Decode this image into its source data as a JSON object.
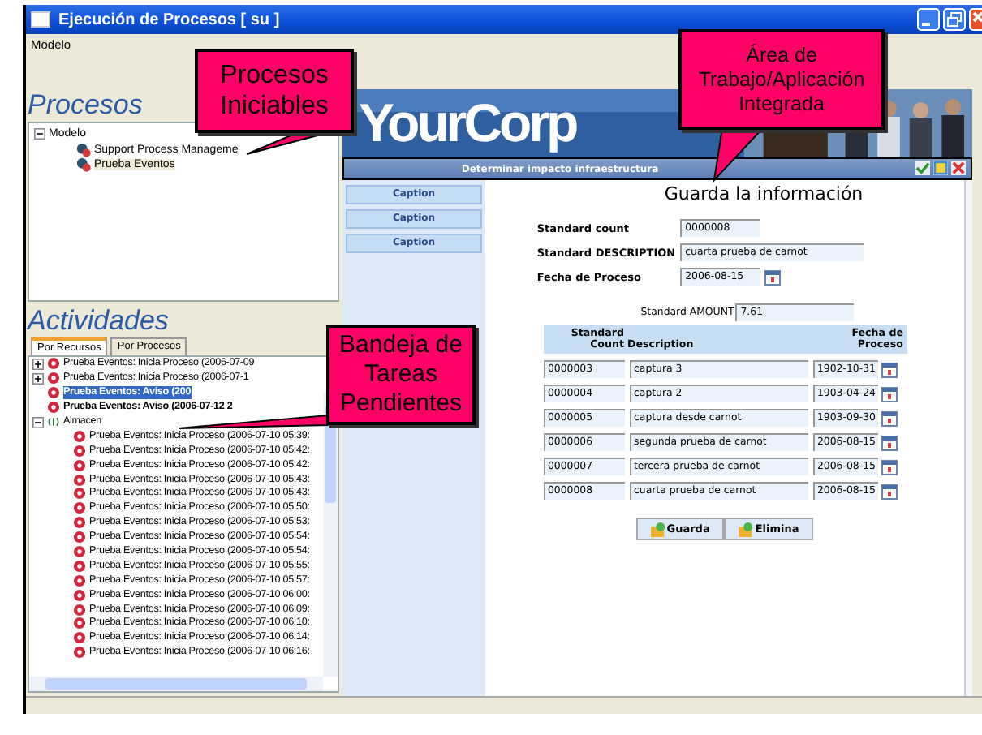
{
  "window": {
    "title": "Ejecución de Procesos [ su ]"
  },
  "menu": [
    "Modelo"
  ],
  "procesos": {
    "heading": "Procesos",
    "tree": [
      {
        "label": "Modelo",
        "expanded": true,
        "children": [
          {
            "label": "Support Process Manageme",
            "selected": false
          },
          {
            "label": "Prueba Eventos",
            "selected": true
          }
        ]
      }
    ]
  },
  "actividades": {
    "heading": "Actividades",
    "tabs": [
      {
        "label": "Por Recursos",
        "selected": true
      },
      {
        "label": "Por Procesos",
        "selected": false
      }
    ],
    "items": [
      {
        "kind": "branch",
        "label": "Prueba Eventos: Inicia Proceso (2006-07-09",
        "expanded": false,
        "unread": false,
        "selected": false
      },
      {
        "kind": "branch",
        "label": "Prueba Eventos: Inicia Proceso (2006-07-1",
        "expanded": false,
        "unread": false,
        "selected": false
      },
      {
        "kind": "event",
        "label": "Prueba Eventos: Aviso (200",
        "unread": true,
        "selected": true
      },
      {
        "kind": "event",
        "label": "Prueba Eventos: Aviso (2006-07-12 2",
        "unread": true,
        "selected": false
      },
      {
        "kind": "group",
        "label": "Almacen",
        "expanded": true,
        "unread": false,
        "selected": false,
        "children": [
          {
            "label": "Prueba Eventos: Inicia Proceso (2006-07-10 05:39:",
            "selected": false
          },
          {
            "label": "Prueba Eventos: Inicia Proceso (2006-07-10 05:42:",
            "selected": false
          },
          {
            "label": "Prueba Eventos: Inicia Proceso (2006-07-10 05:42:",
            "selected": false
          },
          {
            "label": "Prueba Eventos: Inicia Proceso (2006-07-10 05:43:",
            "selected": false
          },
          {
            "label": "Prueba Eventos: Inicia Proceso (2006-07-10 05:43:",
            "selected": false
          },
          {
            "label": "Prueba Eventos: Inicia Proceso (2006-07-10 05:50:",
            "selected": false
          },
          {
            "label": "Prueba Eventos: Inicia Proceso (2006-07-10 05:53:",
            "selected": false
          },
          {
            "label": "Prueba Eventos: Inicia Proceso (2006-07-10 05:54:",
            "selected": false
          },
          {
            "label": "Prueba Eventos: Inicia Proceso (2006-07-10 05:54:",
            "selected": false
          },
          {
            "label": "Prueba Eventos: Inicia Proceso (2006-07-10 05:55:",
            "selected": false
          },
          {
            "label": "Prueba Eventos: Inicia Proceso (2006-07-10 05:57:",
            "selected": false
          },
          {
            "label": "Prueba Eventos: Inicia Proceso (2006-07-10 06:00:",
            "selected": false
          },
          {
            "label": "Prueba Eventos: Inicia Proceso (2006-07-10 06:09:",
            "selected": false
          },
          {
            "label": "Prueba Eventos: Inicia Proceso (2006-07-10 06:10:",
            "selected": false
          },
          {
            "label": "Prueba Eventos: Inicia Proceso (2006-07-10 06:14:",
            "selected": false
          },
          {
            "label": "Prueba Eventos: Inicia Proceso (2006-07-10 06:16:",
            "selected": false
          }
        ]
      }
    ]
  },
  "workspace": {
    "brand": "YourCorp",
    "form_title": "Determinar impacto infraestructura",
    "captions": [
      "Caption",
      "Caption",
      "Caption"
    ],
    "heading": "Guarda la información",
    "fields": [
      {
        "kind": "text",
        "label": "Standard count",
        "value": "0000008"
      },
      {
        "kind": "text",
        "label": "Standard DESCRIPTION",
        "value": "cuarta prueba de carnot"
      },
      {
        "kind": "date",
        "label": "Fecha de Proceso",
        "value": "2006-08-15"
      }
    ],
    "amount": {
      "label": "Standard AMOUNT",
      "value": "7.61"
    },
    "table": {
      "columns": [
        "Standard Count",
        "Description",
        "Fecha de Proceso"
      ],
      "rows": [
        [
          "0000003",
          "captura 3",
          "1902-10-31"
        ],
        [
          "0000004",
          "captura 2",
          "1903-04-24"
        ],
        [
          "0000005",
          "captura desde carnot",
          "1903-09-30"
        ],
        [
          "0000006",
          "segunda prueba de carnot",
          "2006-08-15"
        ],
        [
          "0000007",
          "tercera prueba de carnot",
          "2006-08-15"
        ],
        [
          "0000008",
          "cuarta prueba de carnot",
          "2006-08-15"
        ]
      ]
    },
    "buttons": [
      "Guarda",
      "Elimina"
    ]
  },
  "callouts": [
    {
      "text": "Procesos Iniciables"
    },
    {
      "text": "Área de Trabajo/Aplicación Integrada"
    },
    {
      "text": "Bandeja de Tareas Pendientes"
    }
  ]
}
